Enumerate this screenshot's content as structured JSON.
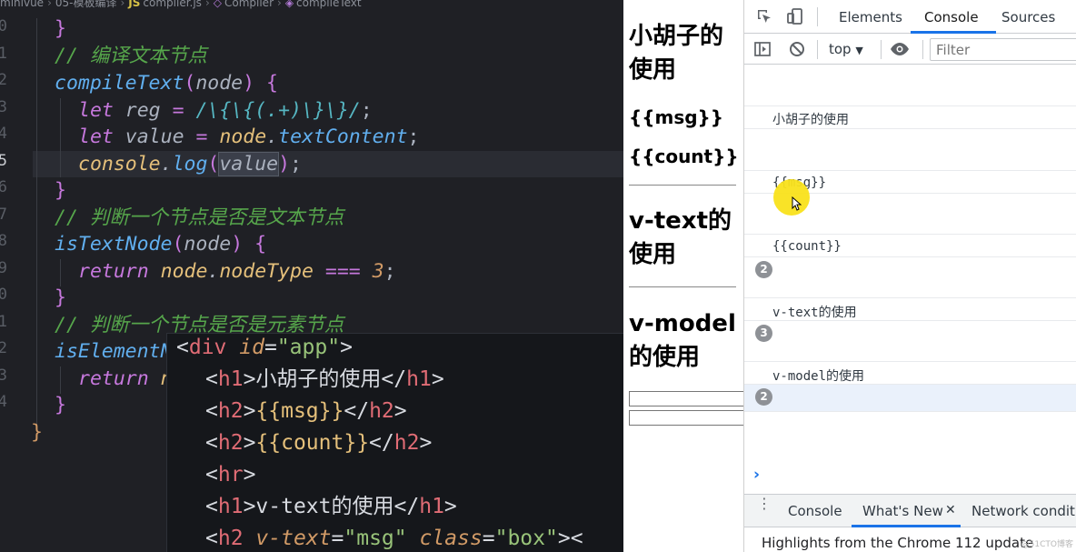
{
  "editor": {
    "breadcrumb": [
      "minivue",
      "05-模板编译",
      "compiler.js",
      "Compiler",
      "compileText"
    ],
    "line_numbers": [
      "0",
      "1",
      "2",
      "3",
      "4",
      "5",
      "6",
      "7",
      "8",
      "9",
      "0",
      "1",
      "2",
      "3",
      "4"
    ],
    "active_line": "5",
    "code": {
      "l0_brace": "}",
      "l1_comment": "// 编译文本节点",
      "l2_fn": "compileText",
      "l2_param": "node",
      "l3_kw": "let",
      "l3_name": "reg",
      "l3_regex": "/\\{\\{(.+)\\}\\}/",
      "l4_kw": "let",
      "l4_name": "value",
      "l4_obj": "node",
      "l4_prop": "textContent",
      "l5_obj": "console",
      "l5_method": "log",
      "l5_arg": "value",
      "l6_brace": "}",
      "l7_comment": "// 判断一个节点是否是文本节点",
      "l8_fn": "isTextNode",
      "l8_param": "node",
      "l9_kw": "return",
      "l9_obj": "node",
      "l9_prop": "nodeType",
      "l9_op": "===",
      "l9_num": "3",
      "l10_brace": "}",
      "l11_comment": "// 判断一个节点是否是元素节点",
      "l12_fn": "isElementN",
      "l13_kw": "return",
      "l13_rest": "n",
      "l14_brace": "}",
      "l15_brace": "}"
    },
    "popup": {
      "l1_tag": "div",
      "l1_attr": "id",
      "l1_val": "\"app\"",
      "l2_tag": "h1",
      "l2_text": "小胡子的使用",
      "l3_tag": "h2",
      "l3_text": "{{msg}}",
      "l4_tag": "h2",
      "l4_text": "{{count}}",
      "l5_tag": "hr",
      "l6_tag": "h1",
      "l6_text": "v-text的使用",
      "l7_tag": "h2",
      "l7_attr1": "v-text",
      "l7_val1": "\"msg\"",
      "l7_attr2": "class",
      "l7_val2": "\"box\"",
      "l7_tail": "><"
    }
  },
  "preview": {
    "h1_a": "小胡子的",
    "h1_b": "使用",
    "h2_msg": "{{msg}}",
    "h2_count": "{{count}}",
    "h1_vtext_a": "v-text的",
    "h1_vtext_b": "使用",
    "h1_vmodel_a": "v-model",
    "h1_vmodel_b": "的使用"
  },
  "devtools": {
    "tabs": [
      "Elements",
      "Console",
      "Sources"
    ],
    "active_tab": "Console",
    "context": "top",
    "filter_placeholder": "Filter",
    "messages": [
      {
        "text": "小胡子的使用",
        "count": ""
      },
      {
        "text": "{{msg}}",
        "count": ""
      },
      {
        "text": "{{count}}",
        "count": "2"
      },
      {
        "text": "v-text的使用",
        "count": "3"
      },
      {
        "text": "v-model的使用",
        "count": "2"
      }
    ],
    "prompt": "›",
    "drawer_tabs": [
      "Console",
      "What's New",
      "Network conditi"
    ],
    "drawer_active": "What's New",
    "drawer_close": "✕",
    "highlights": "Highlights from the Chrome 112 update",
    "watermark": "@51CTO博客",
    "accent": "#1a73e8"
  }
}
